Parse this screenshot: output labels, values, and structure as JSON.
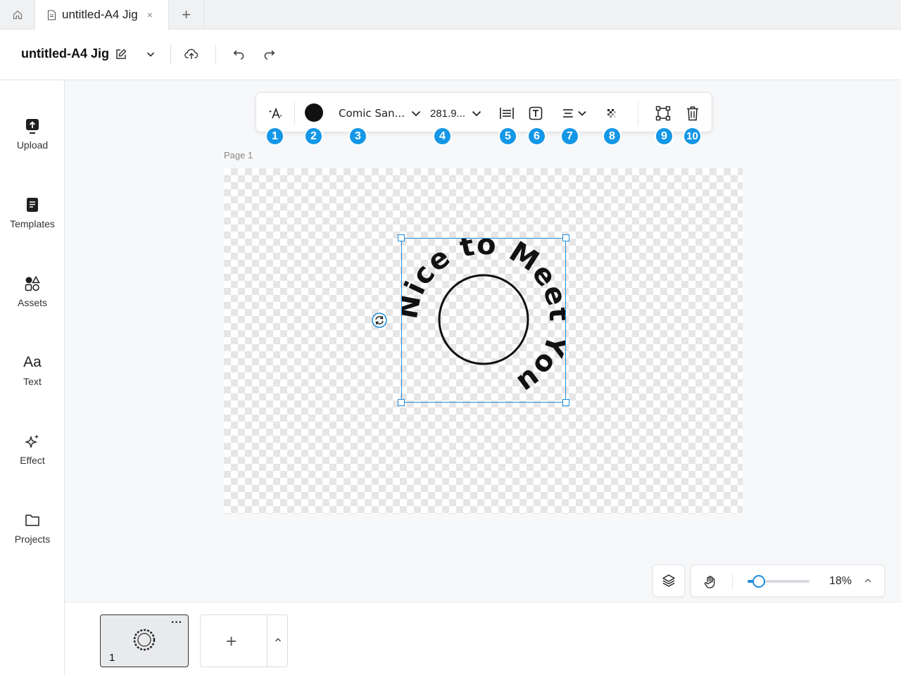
{
  "tabs": {
    "doc_tab_label": "untitled-A4 Jig",
    "close_glyph": "×",
    "add_glyph": "+"
  },
  "header": {
    "title": "untitled-A4 Jig"
  },
  "sidebar": {
    "items": [
      {
        "label": "Upload",
        "icon": "upload-icon"
      },
      {
        "label": "Templates",
        "icon": "templates-icon"
      },
      {
        "label": "Assets",
        "icon": "assets-icon"
      },
      {
        "label": "Text",
        "icon": "text-icon",
        "glyph": "Aa"
      },
      {
        "label": "Effect",
        "icon": "effect-icon"
      },
      {
        "label": "Projects",
        "icon": "projects-icon"
      }
    ]
  },
  "toolbar": {
    "font_name": "Comic San...",
    "font_size": "281.9...",
    "color": "#111111",
    "badges": [
      "1",
      "2",
      "3",
      "4",
      "5",
      "6",
      "7",
      "8",
      "9",
      "10"
    ],
    "badge_color": "#1497e6"
  },
  "canvas": {
    "page_label": "Page 1",
    "curved_text": "Nice to Meet You",
    "selection_color": "#1f8ee0"
  },
  "zoom": {
    "value_label": "18%",
    "level_fraction": 0.18
  },
  "pages": {
    "thumb_number": "1",
    "thumb_more": "···",
    "add_glyph": "+"
  }
}
